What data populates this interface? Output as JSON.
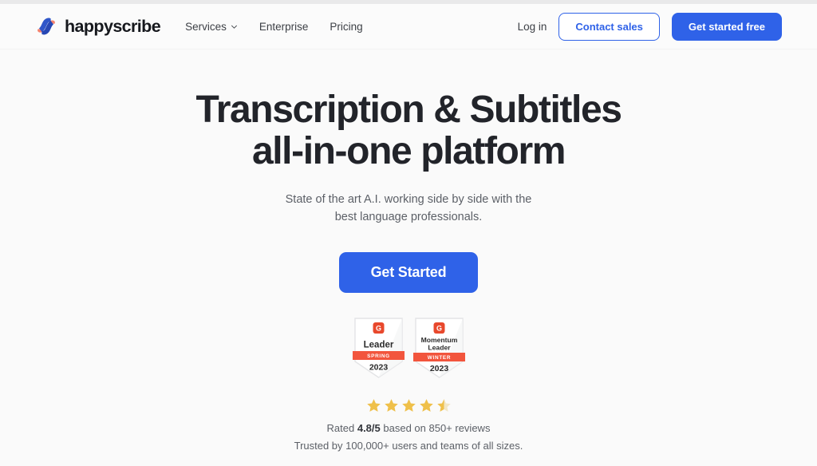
{
  "brand": {
    "name": "happyscribe",
    "logo_icon": "happyscribe-s-logo",
    "logo_colors": {
      "blue": "#2f56c9",
      "coral": "#f4836f"
    }
  },
  "header": {
    "nav": [
      {
        "label": "Services",
        "has_dropdown": true,
        "icon": "chevron-down-icon"
      },
      {
        "label": "Enterprise",
        "has_dropdown": false
      },
      {
        "label": "Pricing",
        "has_dropdown": false
      }
    ],
    "login_label": "Log in",
    "contact_sales_label": "Contact sales",
    "get_started_free_label": "Get started free"
  },
  "hero": {
    "title_line1": "Transcription & Subtitles",
    "title_line2": "all-in-one platform",
    "subtitle": "State of the art A.I. working side by side with the best language professionals.",
    "cta_label": "Get Started"
  },
  "badges": [
    {
      "provider_icon": "g2-logo-icon",
      "title_line1": "Leader",
      "title_line2": "",
      "ribbon": "SPRING",
      "year": "2023"
    },
    {
      "provider_icon": "g2-logo-icon",
      "title_line1": "Momentum",
      "title_line2": "Leader",
      "ribbon": "WINTER",
      "year": "2023"
    }
  ],
  "rating": {
    "stars_total": 5,
    "stars_filled": 4,
    "stars_half": 1,
    "star_color": "#efc04a",
    "prefix": "Rated ",
    "score": "4.8/5",
    "suffix": " based on 850+ reviews"
  },
  "trusted_text": "Trusted by 100,000+ users and teams of all sizes.",
  "colors": {
    "accent_blue": "#2f62e8",
    "ribbon_orange": "#f2553d",
    "g2_red": "#e8482c",
    "page_bg": "#fafafa"
  }
}
